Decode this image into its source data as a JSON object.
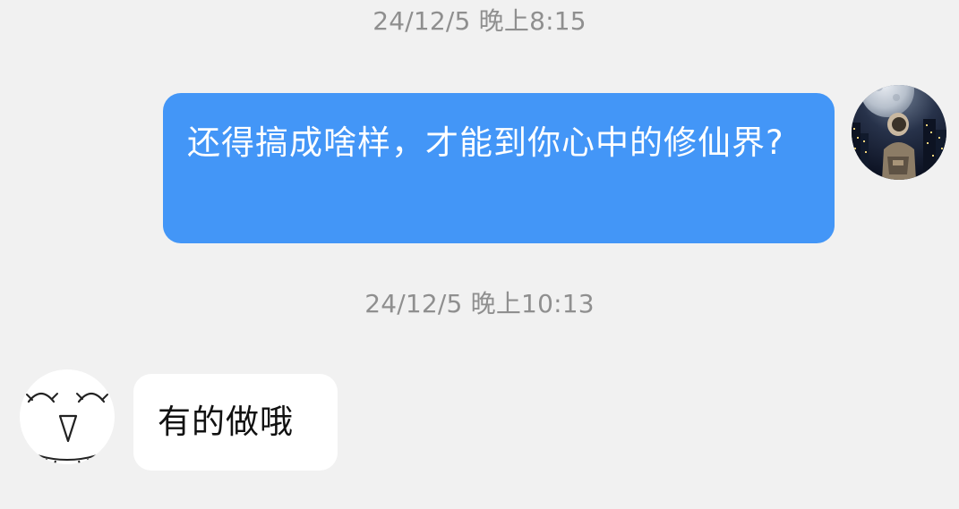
{
  "chat": {
    "messages": [
      {
        "timestamp": "24/12/5 晚上8:15",
        "sender": "self",
        "text": "还得搞成啥样，才能到你心中的修仙界?",
        "avatar_icon": "astronaut-moon-avatar-icon"
      },
      {
        "timestamp": "24/12/5 晚上10:13",
        "sender": "other",
        "text": "有的做哦",
        "avatar_icon": "smiling-face-avatar-icon"
      }
    ]
  },
  "colors": {
    "background": "#f1f1f1",
    "outgoing_bubble": "#4396f7",
    "incoming_bubble": "#ffffff",
    "timestamp_text": "#8f8f8f"
  }
}
